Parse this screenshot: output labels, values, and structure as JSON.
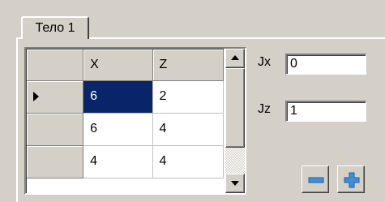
{
  "tab": {
    "label": "Тело 1"
  },
  "grid": {
    "columns": [
      "X",
      "Z"
    ],
    "rows": [
      {
        "x": "6",
        "z": "2",
        "current": true,
        "selected_col": "x"
      },
      {
        "x": "6",
        "z": "4",
        "current": false
      },
      {
        "x": "4",
        "z": "4",
        "current": false
      }
    ]
  },
  "fields": {
    "jx": {
      "label": "Jx",
      "value": "0"
    },
    "jz": {
      "label": "Jz",
      "value": "1"
    }
  },
  "buttons": {
    "remove_icon": "minus-icon",
    "add_icon": "plus-icon"
  },
  "colors": {
    "selection": "#0a246a",
    "icon_accent": "#3f8fd8",
    "face": "#d4d0c8"
  }
}
